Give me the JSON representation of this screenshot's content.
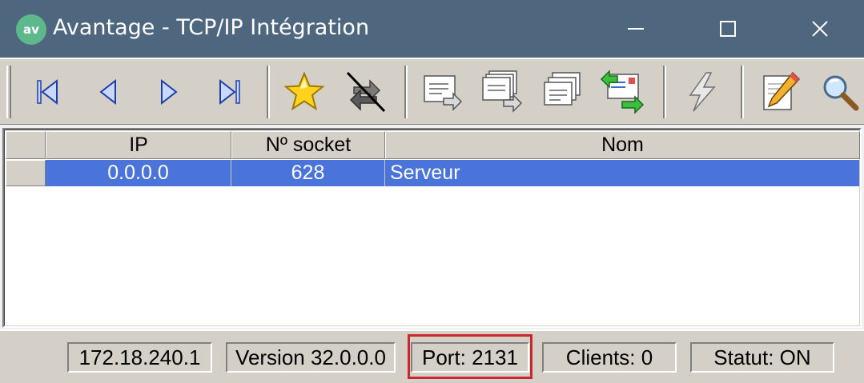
{
  "window": {
    "title": "Avantage - TCP/IP Intégration",
    "app_icon_text": "av",
    "controls": [
      "minimize",
      "maximize",
      "close"
    ]
  },
  "toolbar": {
    "buttons": [
      {
        "icon": "first-record-icon"
      },
      {
        "icon": "previous-record-icon"
      },
      {
        "icon": "next-record-icon"
      },
      {
        "icon": "last-record-icon"
      },
      {
        "icon": "star-icon"
      },
      {
        "icon": "disconnect-icon"
      },
      {
        "icon": "send-message-icon"
      },
      {
        "icon": "send-multiple-messages-icon"
      },
      {
        "icon": "messages-icon"
      },
      {
        "icon": "exchange-messages-icon"
      },
      {
        "icon": "lightning-icon"
      },
      {
        "icon": "edit-icon"
      },
      {
        "icon": "search-icon"
      }
    ]
  },
  "grid": {
    "columns": [
      "IP",
      "Nº socket",
      "Nom"
    ],
    "rows": [
      {
        "ip": "0.0.0.0",
        "socket": "628",
        "name": "Serveur",
        "selected": true
      }
    ]
  },
  "status": {
    "ip": "172.18.240.1",
    "version": "Version 32.0.0.0",
    "port": "Port: 2131",
    "clients": "Clients: 0",
    "statut": "Statut: ON"
  },
  "colors": {
    "titlebar": "#4f667f",
    "selection": "#4a74d9",
    "highlight_border": "#c8282e",
    "toolbar": "#d4d0c8"
  }
}
